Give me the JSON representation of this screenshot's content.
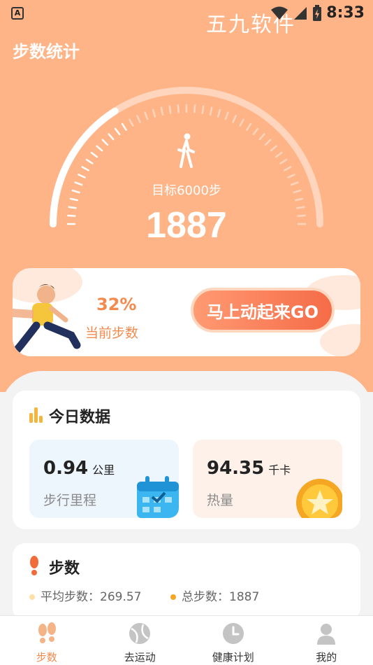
{
  "status_bar": {
    "app_icon_letter": "A",
    "watermark": "五九软件",
    "time": "8:33"
  },
  "page_title": "步数统计",
  "gauge": {
    "goal_text": "目标6000步",
    "current_steps": "1887",
    "progress_fraction": 0.32
  },
  "banner": {
    "percent": "32%",
    "percent_label": "当前步数",
    "go_button": "马上动起来GO"
  },
  "today": {
    "title": "今日数据",
    "distance": {
      "value": "0.94",
      "unit": "公里",
      "label": "步行里程"
    },
    "calories": {
      "value": "94.35",
      "unit": "千卡",
      "label": "热量"
    }
  },
  "steps_card": {
    "title": "步数",
    "avg_text": "平均步数：269.57",
    "total_text": "总步数：1887"
  },
  "bottom_nav": {
    "items": [
      {
        "label": "步数",
        "icon": "footprints-icon",
        "active": true
      },
      {
        "label": "去运动",
        "icon": "ball-icon",
        "active": false
      },
      {
        "label": "健康计划",
        "icon": "clock-icon",
        "active": false
      },
      {
        "label": "我的",
        "icon": "person-icon",
        "active": false
      }
    ]
  },
  "colors": {
    "hero_bg": "#ffb487",
    "accent": "#f28a4e",
    "go_button": "#f56c48"
  }
}
